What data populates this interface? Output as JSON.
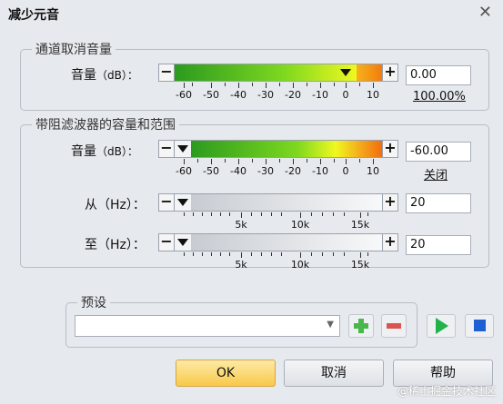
{
  "window": {
    "title": "减少元音"
  },
  "group_channel": {
    "legend": "通道取消音量",
    "volume_label": "音量",
    "volume_unit": "（dB）：",
    "volume_value": "0.00",
    "percent": "100.00%",
    "ticks": [
      "-60",
      "-50",
      "-40",
      "-30",
      "-20",
      "-10",
      "0",
      "10"
    ]
  },
  "group_band": {
    "legend": "带阻滤波器的容量和范围",
    "volume_label": "音量",
    "volume_unit": "（dB）：",
    "volume_value": "-60.00",
    "off_link": "关闭",
    "ticks": [
      "-60",
      "-50",
      "-40",
      "-30",
      "-20",
      "-10",
      "0",
      "10"
    ],
    "from_label": "从（Hz）：",
    "from_value": "20",
    "to_label": "至（Hz）：",
    "to_value": "20",
    "hz_ticks": [
      "5k",
      "10k",
      "15k"
    ]
  },
  "preset": {
    "legend": "预设",
    "value": ""
  },
  "buttons": {
    "ok": "OK",
    "cancel": "取消",
    "help": "帮助"
  },
  "watermark": "@稀土掘金技术社区",
  "colors": {
    "accent_green": "#2aa52a",
    "accent_orange": "#f28a14",
    "ok_button": "#f8c94a",
    "play_green": "#21b24a",
    "stop_blue": "#1f5fd4"
  }
}
